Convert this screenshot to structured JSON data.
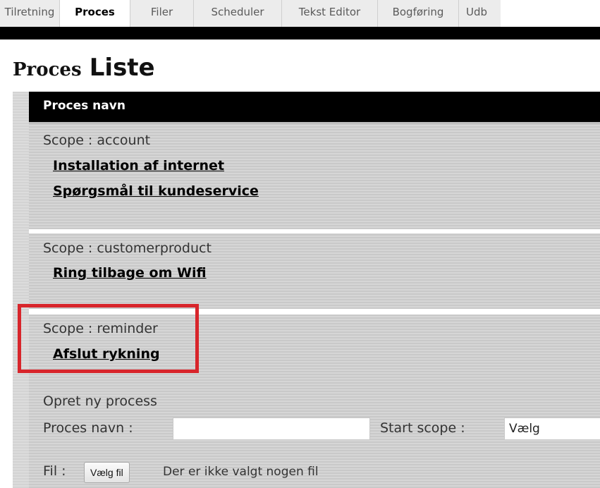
{
  "tabs": [
    {
      "label": "Tilretning",
      "active": false
    },
    {
      "label": "Proces",
      "active": true
    },
    {
      "label": "Filer",
      "active": false
    },
    {
      "label": "Scheduler",
      "active": false
    },
    {
      "label": "Tekst Editor",
      "active": false
    },
    {
      "label": "Bogføring",
      "active": false
    },
    {
      "label": "Udb",
      "active": false
    }
  ],
  "page_title": {
    "small": "Proces",
    "large": "Liste"
  },
  "table": {
    "header": "Proces navn",
    "groups": [
      {
        "scope": "Scope : account",
        "processes": [
          "Installation af internet",
          "Spørgsmål til kundeservice"
        ]
      },
      {
        "scope": "Scope : customerproduct",
        "processes": [
          "Ring tilbage om Wifi"
        ]
      },
      {
        "scope": "Scope : reminder",
        "processes": [
          "Afslut rykning"
        ]
      }
    ]
  },
  "create": {
    "title": "Opret ny process",
    "name_label": "Proces navn :",
    "name_value": "",
    "scope_label": "Start scope :",
    "scope_selected": "Vælg",
    "file_label": "Fil :",
    "file_button": "Vælg fil",
    "file_status": "Der er ikke valgt nogen fil"
  },
  "colors": {
    "highlight": "#d8252b",
    "header_bg": "#000000"
  }
}
